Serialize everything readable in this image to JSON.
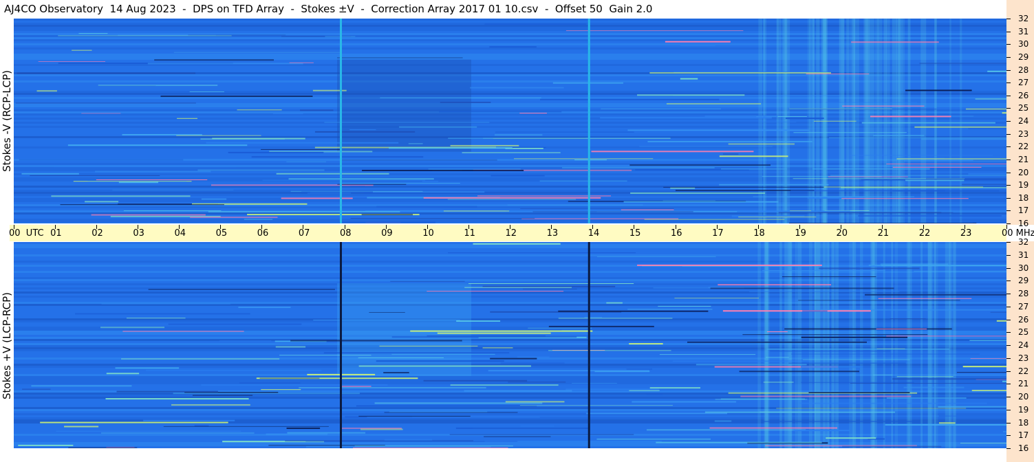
{
  "title": "AJ4CO Observatory  14 Aug 2023  -  DPS on TFD Array  -  Stokes ±V  -  Correction Array 2017 01 10.csv  -  Offset 50  Gain 2.0",
  "colors": {
    "background": "#2270e6",
    "time_bar": "#fffbc2",
    "freq_bar": "#fde4cc"
  },
  "chart_data": {
    "type": "heatmap",
    "title": "AJ4CO Observatory  14 Aug 2023  -  DPS on TFD Array  -  Stokes ±V  -  Correction Array 2017 01 10.csv  -  Offset 50  Gain 2.0",
    "x_unit_label": "UTC",
    "y_unit_label": "MHz",
    "x_ticks": [
      "00",
      "01",
      "02",
      "03",
      "04",
      "05",
      "06",
      "07",
      "08",
      "09",
      "10",
      "11",
      "12",
      "13",
      "14",
      "15",
      "16",
      "17",
      "18",
      "19",
      "20",
      "21",
      "22",
      "23",
      "00"
    ],
    "y_ticks": [
      "32",
      "31",
      "30",
      "29",
      "28",
      "27",
      "26",
      "25",
      "24",
      "23",
      "22",
      "21",
      "20",
      "19",
      "18",
      "17",
      "16"
    ],
    "xlim": [
      0,
      24
    ],
    "ylim": [
      16,
      32
    ],
    "panels": [
      {
        "ylabel": "Stokes -V (RCP-LCP)",
        "vertical_markers_utc": [
          7.9,
          13.9
        ],
        "marker_color": "#29b8e8"
      },
      {
        "ylabel": "Stokes +V (LCP-RCP)",
        "vertical_markers_utc": [
          7.9,
          13.9
        ],
        "marker_color": "#0a1a40"
      }
    ]
  }
}
